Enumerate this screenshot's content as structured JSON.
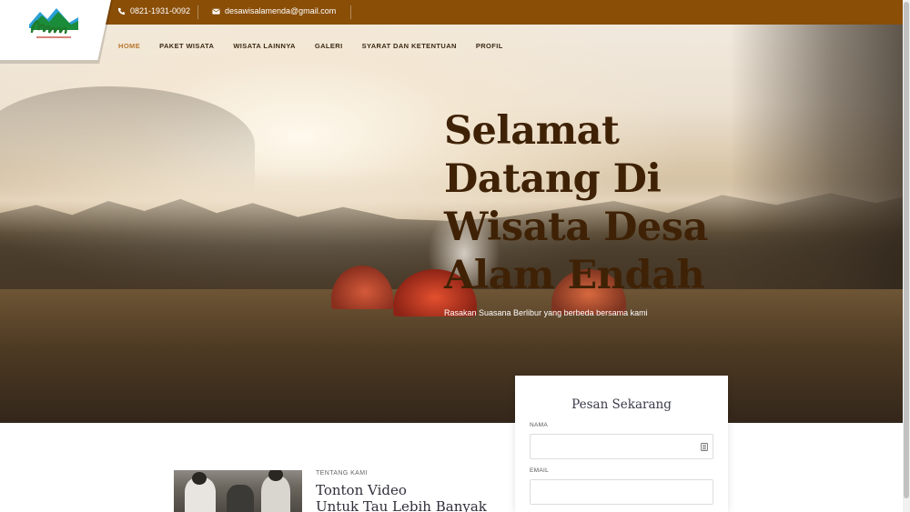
{
  "topbar": {
    "phone": "0821-1931-0092",
    "email": "desawisalamenda@gmail.com",
    "background": "#8a4e07"
  },
  "logo": {
    "text": "Dawala",
    "tagline": "Desa Wisata Alamenda",
    "icon": "mountain-logo"
  },
  "nav": {
    "items": [
      {
        "label": "HOME",
        "active": true
      },
      {
        "label": "PAKET WISATA",
        "active": false
      },
      {
        "label": "WISATA LAINNYA",
        "active": false
      },
      {
        "label": "GALERI",
        "active": false
      },
      {
        "label": "SYARAT DAN KETENTUAN",
        "active": false
      },
      {
        "label": "PROFIL",
        "active": false
      }
    ],
    "active_color": "#b8752c"
  },
  "hero": {
    "title_lines": [
      "Selamat",
      "Datang Di",
      "Wisata Desa",
      "Alam Endah"
    ],
    "subtitle": "Rasakan Suasana Berlibur yang berbeda bersama kami",
    "title_color": "#3f2206"
  },
  "order_form": {
    "title": "Pesan Sekarang",
    "name_label": "NAMA",
    "name_value": "",
    "email_label": "EMAIL",
    "email_value": ""
  },
  "about": {
    "tag": "TENTANG KAMI",
    "title_lines": [
      "Tonton Video",
      "Untuk Tau Lebih Banyak"
    ]
  }
}
